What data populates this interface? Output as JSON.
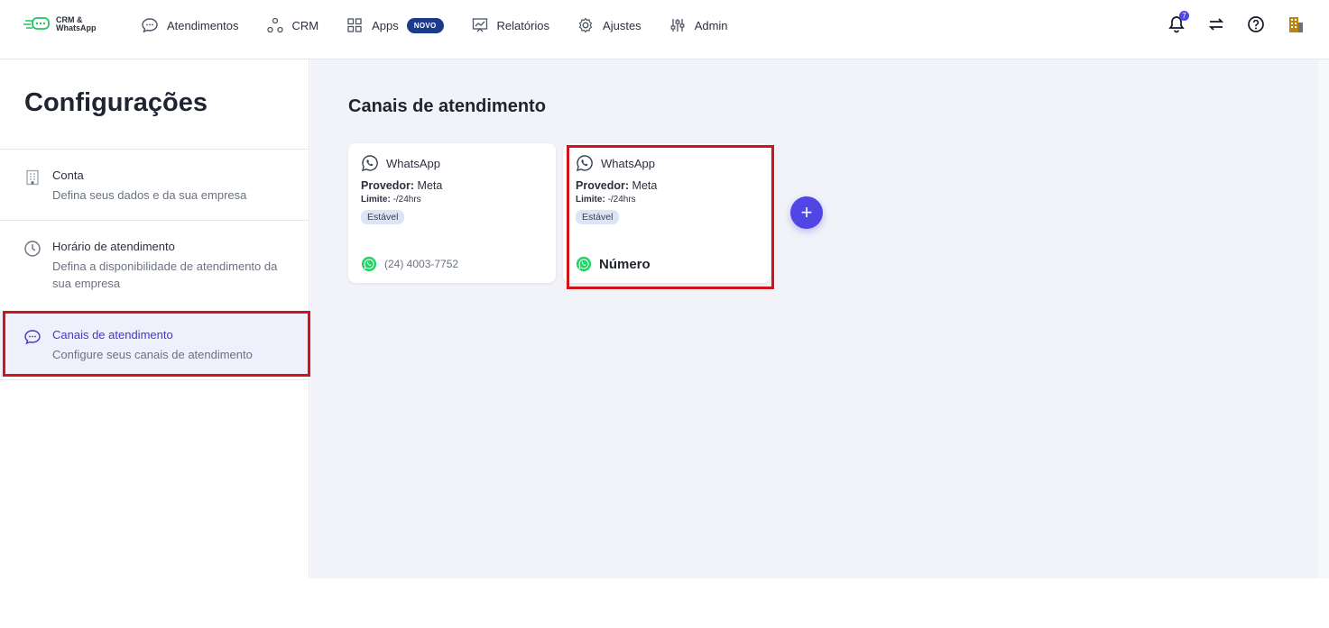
{
  "brand": {
    "line1": "CRM &",
    "line2": "WhatsApp"
  },
  "nav": {
    "atendimentos": "Atendimentos",
    "crm": "CRM",
    "apps": "Apps",
    "apps_badge": "NOVO",
    "relatorios": "Relatórios",
    "ajustes": "Ajustes",
    "admin": "Admin"
  },
  "topright": {
    "notifications_count": "7"
  },
  "sidebar": {
    "title": "Configurações",
    "items": [
      {
        "label": "Conta",
        "desc": "Defina seus dados e da sua empresa",
        "icon": "building-icon"
      },
      {
        "label": "Horário de atendimento",
        "desc": "Defina a disponibilidade de atendimento da sua empresa",
        "icon": "clock-icon"
      },
      {
        "label": "Canais de atendimento",
        "desc": "Configure seus canais de atendimento",
        "icon": "chat-icon"
      }
    ]
  },
  "main": {
    "title": "Canais de atendimento",
    "cards": [
      {
        "channel": "WhatsApp",
        "prov_label": "Provedor:",
        "prov_value": "Meta",
        "limit_label": "Limite:",
        "limit_value": "-/24hrs",
        "status": "Estável",
        "phone": "(24) 4003-7752"
      },
      {
        "channel": "WhatsApp",
        "prov_label": "Provedor:",
        "prov_value": "Meta",
        "limit_label": "Limite:",
        "limit_value": "-/24hrs",
        "status": "Estável",
        "phone": "Número"
      }
    ],
    "add_label": "+"
  },
  "colors": {
    "accent": "#4f46e5",
    "highlight": "#d0141c",
    "whatsapp": "#25d366"
  }
}
